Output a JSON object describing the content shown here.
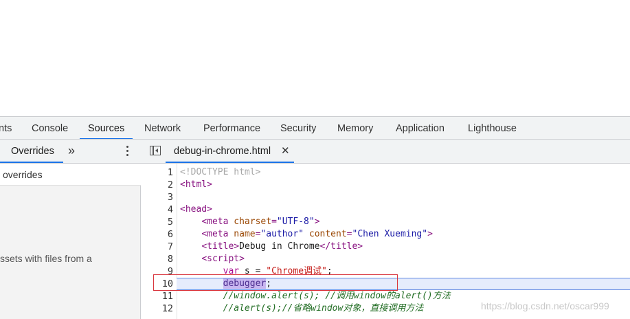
{
  "tabs": [
    {
      "label": "nts",
      "active": false
    },
    {
      "label": "Console",
      "active": false
    },
    {
      "label": "Sources",
      "active": true
    },
    {
      "label": "Network",
      "active": false
    },
    {
      "label": "Performance",
      "active": false
    },
    {
      "label": "Security",
      "active": false
    },
    {
      "label": "Memory",
      "active": false
    },
    {
      "label": "Application",
      "active": false
    },
    {
      "label": "Lighthouse",
      "active": false
    }
  ],
  "navigator": {
    "tab_label": "Overrides",
    "more_tabs_icon": "double-chevron-right-icon",
    "menu_icon": "kebab-menu-icon",
    "item_label": "overrides",
    "message": "ssets with files from a"
  },
  "editor": {
    "toggle_icon": "toggle-navigator-icon",
    "file_tab": {
      "name": "debug-in-chrome.html",
      "close_glyph": "✕"
    },
    "current_line": 10,
    "lines": [
      {
        "n": "1",
        "parts": [
          {
            "t": "<!DOCTYPE html>",
            "c": "doctype"
          }
        ]
      },
      {
        "n": "2",
        "parts": [
          {
            "t": "<html>",
            "c": "tag"
          }
        ]
      },
      {
        "n": "3",
        "parts": []
      },
      {
        "n": "4",
        "parts": [
          {
            "t": "<head>",
            "c": "tag"
          }
        ]
      },
      {
        "n": "5",
        "parts": [
          {
            "t": "    ",
            "c": "text"
          },
          {
            "t": "<meta ",
            "c": "tag"
          },
          {
            "t": "charset",
            "c": "attr"
          },
          {
            "t": "=",
            "c": "tag"
          },
          {
            "t": "\"UTF-8\"",
            "c": "val"
          },
          {
            "t": ">",
            "c": "tag"
          }
        ]
      },
      {
        "n": "6",
        "parts": [
          {
            "t": "    ",
            "c": "text"
          },
          {
            "t": "<meta ",
            "c": "tag"
          },
          {
            "t": "name",
            "c": "attr"
          },
          {
            "t": "=",
            "c": "tag"
          },
          {
            "t": "\"author\"",
            "c": "val"
          },
          {
            "t": " ",
            "c": "tag"
          },
          {
            "t": "content",
            "c": "attr"
          },
          {
            "t": "=",
            "c": "tag"
          },
          {
            "t": "\"Chen Xueming\"",
            "c": "val"
          },
          {
            "t": ">",
            "c": "tag"
          }
        ]
      },
      {
        "n": "7",
        "parts": [
          {
            "t": "    ",
            "c": "text"
          },
          {
            "t": "<title>",
            "c": "tag"
          },
          {
            "t": "Debug in Chrome",
            "c": "text"
          },
          {
            "t": "</title>",
            "c": "tag"
          }
        ]
      },
      {
        "n": "8",
        "parts": [
          {
            "t": "    ",
            "c": "text"
          },
          {
            "t": "<script>",
            "c": "tag"
          }
        ]
      },
      {
        "n": "9",
        "parts": [
          {
            "t": "        ",
            "c": "text"
          },
          {
            "t": "var",
            "c": "kw"
          },
          {
            "t": " s = ",
            "c": "text"
          },
          {
            "t": "\"Chrome调试\"",
            "c": "str"
          },
          {
            "t": ";",
            "c": "text"
          }
        ]
      },
      {
        "n": "10",
        "parts": [
          {
            "t": "        ",
            "c": "text"
          },
          {
            "t": "debugger",
            "c": "hl"
          },
          {
            "t": ";",
            "c": "text"
          }
        ]
      },
      {
        "n": "11",
        "parts": [
          {
            "t": "        ",
            "c": "text"
          },
          {
            "t": "//window.alert(s); //调用window的alert()方法",
            "c": "cm"
          }
        ]
      },
      {
        "n": "12",
        "parts": [
          {
            "t": "        ",
            "c": "text"
          },
          {
            "t": "//alert(s);//省略window对象，直接调用方法",
            "c": "cm"
          }
        ]
      }
    ]
  },
  "watermark": "https://blog.csdn.net/oscar999",
  "colors": {
    "accent": "#1a73e8",
    "breakpoint_box": "#d9363e",
    "current_line_bg": "#e6ecfc"
  }
}
